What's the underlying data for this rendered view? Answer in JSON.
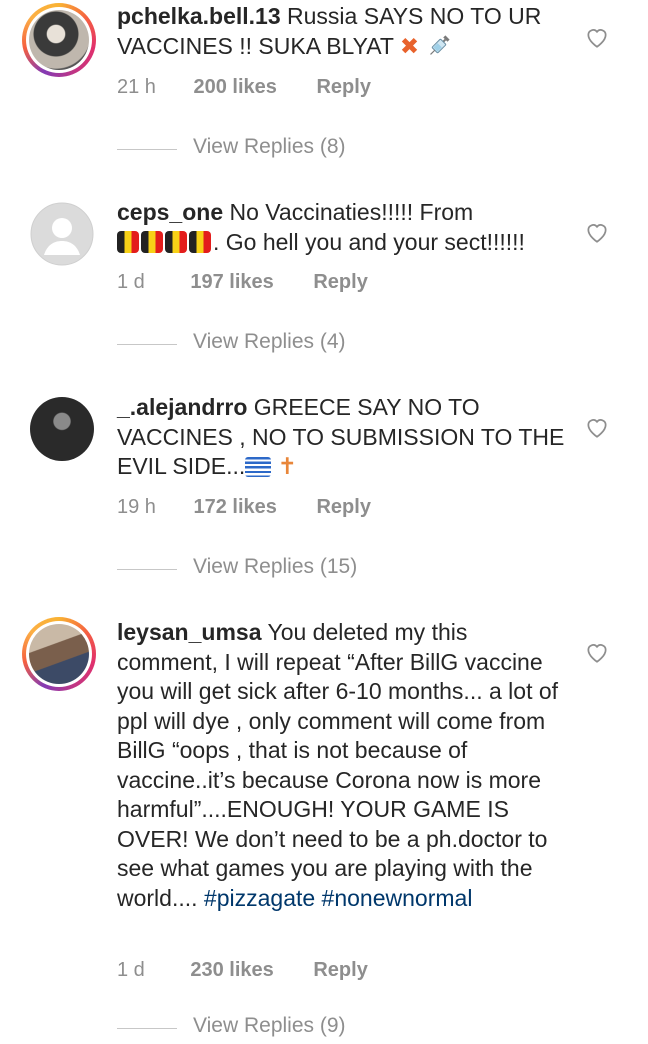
{
  "comments": [
    {
      "username": "pchelka.bell.13",
      "text": "Russia SAYS NO TO UR VACCINES !! SUKA BLYAT",
      "emoji_icons": [
        "cross-mark-icon",
        "syringe-icon"
      ],
      "time": "21 h",
      "likes": "200 likes",
      "reply": "Reply",
      "view_replies": "View Replies (8)"
    },
    {
      "username": "ceps_one",
      "text_before": "No Vaccinaties!!!!! From",
      "emoji_icons": [
        "belgium-flag-icon",
        "belgium-flag-icon",
        "belgium-flag-icon",
        "belgium-flag-icon"
      ],
      "text_after": ". Go hell you and your sect!!!!!!",
      "time": "1 d",
      "likes": "197 likes",
      "reply": "Reply",
      "view_replies": "View Replies (4)"
    },
    {
      "username": "_.alejandrro",
      "text": "GREECE SAY NO TO VACCINES , NO TO SUBMISSION TO THE EVIL SIDE...",
      "emoji_icons": [
        "greece-flag-icon",
        "latin-cross-icon"
      ],
      "time": "19 h",
      "likes": "172 likes",
      "reply": "Reply",
      "view_replies": "View Replies (15)"
    },
    {
      "username": "leysan_umsa",
      "text": "You deleted my this comment, I will repeat “After BillG vaccine you will get sick after 6-10 months... a lot of ppl will dye , only comment will come from BillG “oops , that is not because of vaccine..it’s because Corona now is more harmful”....ENOUGH! YOUR GAME IS OVER! We don’t need to be a ph.doctor to see what games you are playing with the world....",
      "hashtags": "#pizzagate #nonewnormal",
      "time": "1 d",
      "likes": "230 likes",
      "reply": "Reply",
      "view_replies": "View Replies (9)"
    }
  ],
  "colors": {
    "text": "#262626",
    "meta": "#8e8e8e",
    "hashtag": "#00376b",
    "story_ring": "#e1306c"
  }
}
